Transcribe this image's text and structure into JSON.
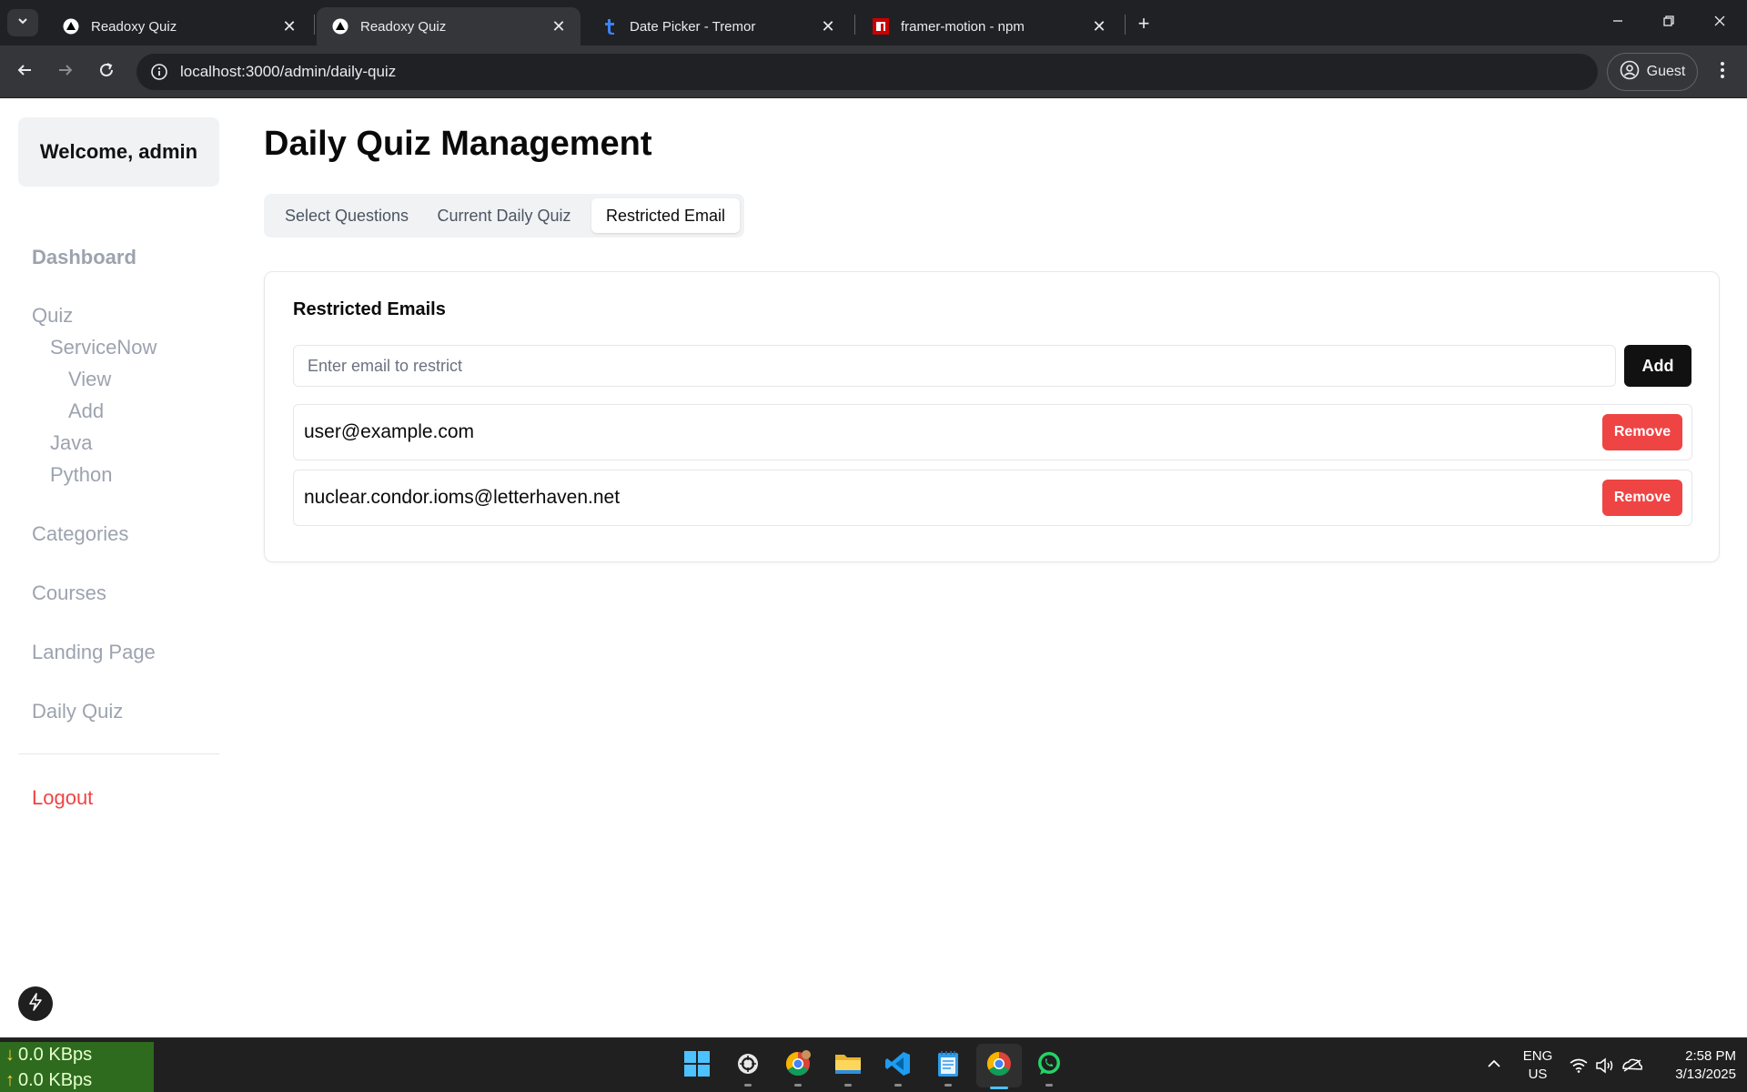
{
  "browser": {
    "tabs": [
      {
        "title": "Readoxy Quiz",
        "icon": "readoxy-logo",
        "active": false
      },
      {
        "title": "Readoxy Quiz",
        "icon": "readoxy-logo",
        "active": true
      },
      {
        "title": "Date Picker - Tremor",
        "icon": "tremor-logo",
        "active": false
      },
      {
        "title": "framer-motion - npm",
        "icon": "npm-logo",
        "active": false
      }
    ],
    "url": "localhost:3000/admin/daily-quiz",
    "profile_label": "Guest"
  },
  "sidebar": {
    "welcome": "Welcome, admin",
    "items": {
      "dashboard": "Dashboard",
      "quiz": "Quiz",
      "servicenow": "ServiceNow",
      "view": "View",
      "add": "Add",
      "java": "Java",
      "python": "Python",
      "categories": "Categories",
      "courses": "Courses",
      "landing_page": "Landing Page",
      "daily_quiz": "Daily Quiz"
    },
    "logout": "Logout"
  },
  "main": {
    "title": "Daily Quiz Management",
    "tabs": [
      "Select Questions",
      "Current Daily Quiz",
      "Restricted Email"
    ],
    "active_tab": "Restricted Email",
    "card": {
      "title": "Restricted Emails",
      "input_placeholder": "Enter email to restrict",
      "input_value": "",
      "add_label": "Add",
      "remove_label": "Remove",
      "emails": [
        "user@example.com",
        "nuclear.condor.ioms@letterhaven.net"
      ]
    }
  },
  "taskbar": {
    "net_down": "0.0 KBps",
    "net_up": "0.0 KBps",
    "lang_line1": "ENG",
    "lang_line2": "US",
    "time": "2:58 PM",
    "date": "3/13/2025"
  },
  "colors": {
    "accent_dark": "#111111",
    "danger": "#ef4444",
    "muted_nav": "#9ca3af",
    "chrome_bg": "#202124"
  }
}
